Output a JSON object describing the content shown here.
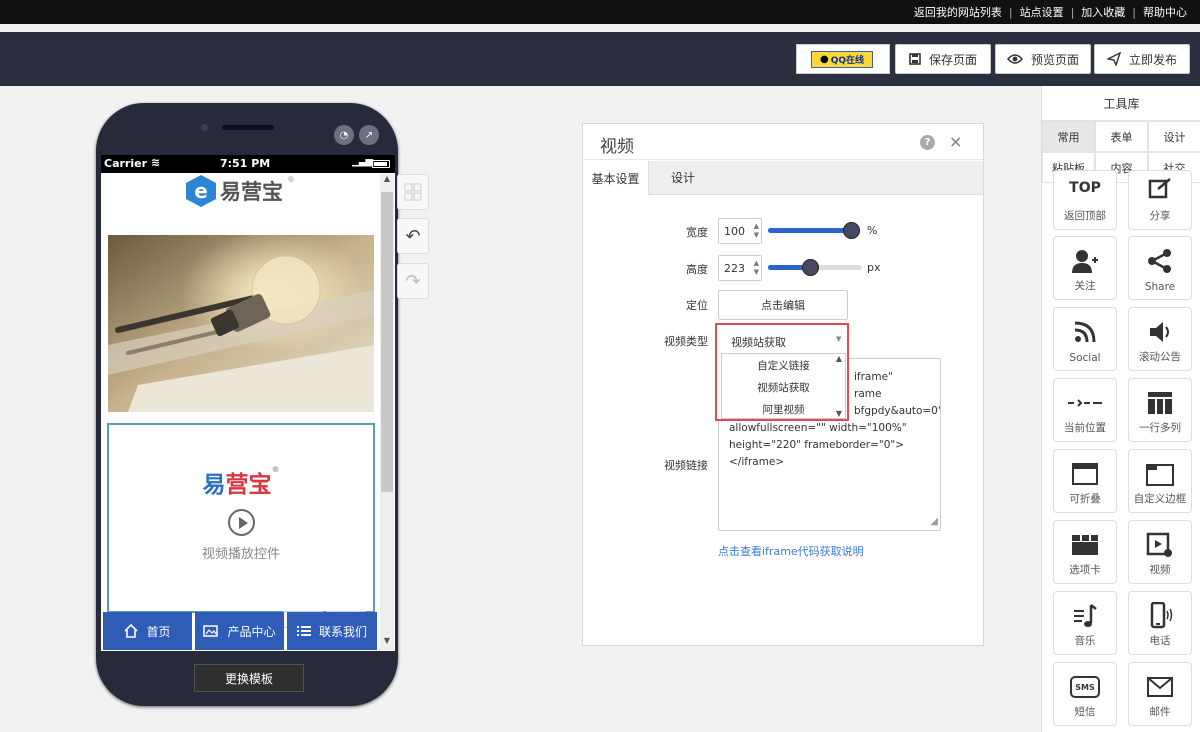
{
  "topbar": {
    "links": [
      "返回我的网站列表",
      "站点设置",
      "加入收藏",
      "帮助中心"
    ]
  },
  "header": {
    "qq_label": "QQ在线",
    "save_label": "保存页面",
    "preview_label": "预览页面",
    "publish_label": "立即发布"
  },
  "phone": {
    "carrier": "Carrier",
    "time": "7:51 PM",
    "logo_text": "易营宝",
    "video_logo_a": "易",
    "video_logo_b": "营宝",
    "video_caption": "视频播放控件",
    "copy_label": "复制",
    "delete_label": "删除",
    "nav": [
      {
        "label": "首页",
        "icon": "home-icon"
      },
      {
        "label": "产品中心",
        "icon": "picture-icon"
      },
      {
        "label": "联系我们",
        "icon": "list-icon"
      }
    ],
    "swap_template": "更换模板"
  },
  "panel": {
    "title": "视频",
    "tabs": [
      "基本设置",
      "设计"
    ],
    "width_label": "宽度",
    "width_value": "100",
    "width_unit": "%",
    "width_level": 1.0,
    "height_label": "高度",
    "height_value": "223",
    "height_unit": "px",
    "height_level": 0.45,
    "position_label": "定位",
    "edit_button": "点击编辑",
    "type_label": "视频类型",
    "type_selected": "视频站获取",
    "type_options": [
      "自定义链接",
      "视频站获取",
      "阿里视频"
    ],
    "link_label": "视频链接",
    "iframe_lines": [
      "iframe\"",
      "rame",
      "bfgpdy&auto=0\"",
      "allowfullscreen=\"\" width=\"100%\"",
      "height=\"220\" frameborder=\"0\">",
      "</iframe>"
    ],
    "help_link": "点击查看iframe代码获取说明"
  },
  "toolbox": {
    "title": "工具库",
    "tabs": [
      "常用",
      "表单",
      "设计",
      "粘贴板",
      "内容",
      "社交"
    ],
    "active_tab": "常用",
    "items": [
      {
        "label": "返回顶部",
        "icon": "top-icon"
      },
      {
        "label": "分享",
        "icon": "share-edit-icon"
      },
      {
        "label": "关注",
        "icon": "follow-user-icon"
      },
      {
        "label": "Share",
        "icon": "share-icon"
      },
      {
        "label": "Social",
        "icon": "rss-icon"
      },
      {
        "label": "滚动公告",
        "icon": "speaker-icon"
      },
      {
        "label": "当前位置",
        "icon": "breadcrumb-icon"
      },
      {
        "label": "一行多列",
        "icon": "columns-icon"
      },
      {
        "label": "可折叠",
        "icon": "collapse-icon"
      },
      {
        "label": "自定义边框",
        "icon": "border-icon"
      },
      {
        "label": "选项卡",
        "icon": "tabs-icon"
      },
      {
        "label": "视频",
        "icon": "video-icon"
      },
      {
        "label": "音乐",
        "icon": "music-icon"
      },
      {
        "label": "电话",
        "icon": "phone-icon"
      },
      {
        "label": "短信",
        "icon": "sms-icon"
      },
      {
        "label": "邮件",
        "icon": "mail-icon"
      }
    ],
    "sms_badge": "SMS",
    "top_badge": "TOP"
  }
}
